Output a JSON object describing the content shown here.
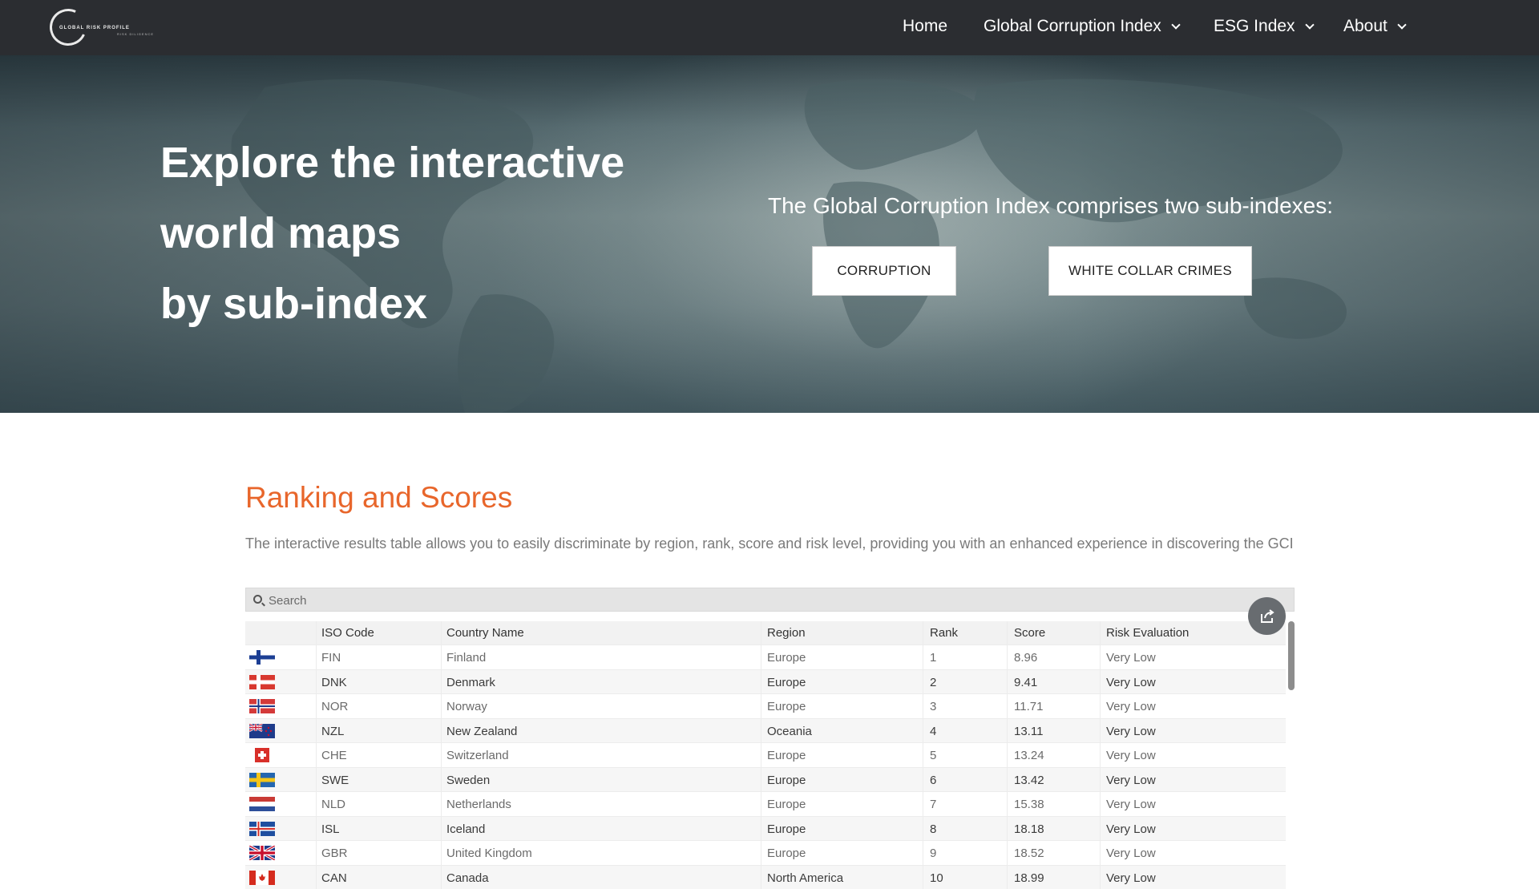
{
  "nav": {
    "logo_text": "GLOBAL RISK PROFILE",
    "logo_subtext": "RISK DILIGENCE",
    "items": [
      {
        "label": "Home",
        "has_dropdown": false
      },
      {
        "label": "Global Corruption Index",
        "has_dropdown": true
      },
      {
        "label": "ESG Index",
        "has_dropdown": true
      },
      {
        "label": "About",
        "has_dropdown": true
      }
    ]
  },
  "hero": {
    "title_lines": [
      "Explore the interactive",
      "world maps",
      "by sub-index"
    ],
    "subtitle": "The Global Corruption Index comprises two sub-indexes:",
    "buttons": [
      "CORRUPTION",
      "WHITE COLLAR CRIMES"
    ]
  },
  "section": {
    "title": "Ranking and Scores",
    "description": "The interactive results table allows you to easily discriminate by region, rank, score and risk level, providing you with an enhanced experience in discovering the GCI"
  },
  "search": {
    "placeholder": "Search"
  },
  "table": {
    "headers": [
      "ISO Code",
      "Country Name",
      "Region",
      "Rank",
      "Score",
      "Risk Evaluation"
    ],
    "rows": [
      {
        "flag": "FIN",
        "iso": "FIN",
        "country": "Finland",
        "region": "Europe",
        "rank": "1",
        "score": "8.96",
        "risk": "Very Low"
      },
      {
        "flag": "DNK",
        "iso": "DNK",
        "country": "Denmark",
        "region": "Europe",
        "rank": "2",
        "score": "9.41",
        "risk": "Very Low"
      },
      {
        "flag": "NOR",
        "iso": "NOR",
        "country": "Norway",
        "region": "Europe",
        "rank": "3",
        "score": "11.71",
        "risk": "Very Low"
      },
      {
        "flag": "NZL",
        "iso": "NZL",
        "country": "New Zealand",
        "region": "Oceania",
        "rank": "4",
        "score": "13.11",
        "risk": "Very Low"
      },
      {
        "flag": "CHE",
        "iso": "CHE",
        "country": "Switzerland",
        "region": "Europe",
        "rank": "5",
        "score": "13.24",
        "risk": "Very Low"
      },
      {
        "flag": "SWE",
        "iso": "SWE",
        "country": "Sweden",
        "region": "Europe",
        "rank": "6",
        "score": "13.42",
        "risk": "Very Low"
      },
      {
        "flag": "NLD",
        "iso": "NLD",
        "country": "Netherlands",
        "region": "Europe",
        "rank": "7",
        "score": "15.38",
        "risk": "Very Low"
      },
      {
        "flag": "ISL",
        "iso": "ISL",
        "country": "Iceland",
        "region": "Europe",
        "rank": "8",
        "score": "18.18",
        "risk": "Very Low"
      },
      {
        "flag": "GBR",
        "iso": "GBR",
        "country": "United Kingdom",
        "region": "Europe",
        "rank": "9",
        "score": "18.52",
        "risk": "Very Low"
      },
      {
        "flag": "CAN",
        "iso": "CAN",
        "country": "Canada",
        "region": "North America",
        "rank": "10",
        "score": "18.99",
        "risk": "Very Low"
      }
    ]
  },
  "colors": {
    "nav_bg": "#2b2d31",
    "accent": "#e8662b",
    "share_button": "#686c70"
  },
  "icons": {
    "search": "search-icon",
    "share": "share-icon",
    "dropdown": "chevron-down-icon"
  }
}
